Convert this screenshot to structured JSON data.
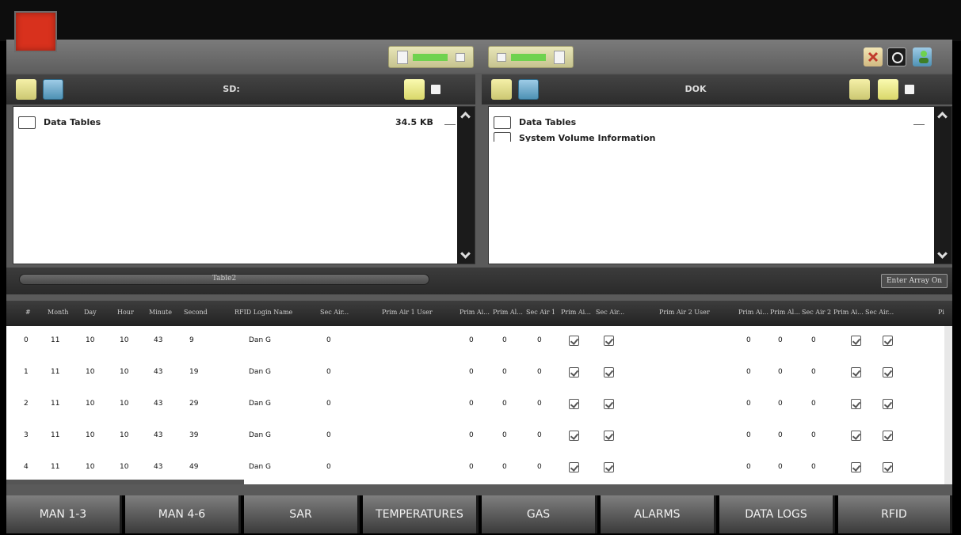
{
  "left_pane": {
    "title": "SD:",
    "files": [
      {
        "name": "Data Tables",
        "size": "34.5 KB"
      }
    ]
  },
  "right_pane": {
    "title": "DOK",
    "files": [
      {
        "name": "Data Tables"
      },
      {
        "name": "System Volume Information"
      }
    ]
  },
  "table_select": {
    "value": "Table2"
  },
  "enter_array_label": "Enter Array On",
  "grid": {
    "columns": [
      "#",
      "Month",
      "Day",
      "Hour",
      "Minute",
      "Second",
      "RFID Login Name",
      "Sec Air...",
      "Prim Air 1 User",
      "Prim Ai...",
      "Prim Al...",
      "Sec Air 1",
      "Prim Ai...",
      "Sec Air...",
      "Prim Air 2 User",
      "Prim Ai...",
      "Prim Al...",
      "Sec Air 2",
      "Prim Ai...",
      "Sec Air...",
      "Pi"
    ],
    "rows": [
      {
        "index": "0",
        "month": "11",
        "day": "10",
        "hour": "10",
        "minute": "43",
        "second": "9",
        "name": "Dan G",
        "sec_air": "0",
        "a": "0",
        "b": "0",
        "c": "0",
        "d": "0",
        "e": "0",
        "f": "0"
      },
      {
        "index": "1",
        "month": "11",
        "day": "10",
        "hour": "10",
        "minute": "43",
        "second": "19",
        "name": "Dan G",
        "sec_air": "0",
        "a": "0",
        "b": "0",
        "c": "0",
        "d": "0",
        "e": "0",
        "f": "0"
      },
      {
        "index": "2",
        "month": "11",
        "day": "10",
        "hour": "10",
        "minute": "43",
        "second": "29",
        "name": "Dan G",
        "sec_air": "0",
        "a": "0",
        "b": "0",
        "c": "0",
        "d": "0",
        "e": "0",
        "f": "0"
      },
      {
        "index": "3",
        "month": "11",
        "day": "10",
        "hour": "10",
        "minute": "43",
        "second": "39",
        "name": "Dan G",
        "sec_air": "0",
        "a": "0",
        "b": "0",
        "c": "0",
        "d": "0",
        "e": "0",
        "f": "0"
      },
      {
        "index": "4",
        "month": "11",
        "day": "10",
        "hour": "10",
        "minute": "43",
        "second": "49",
        "name": "Dan G",
        "sec_air": "0",
        "a": "0",
        "b": "0",
        "c": "0",
        "d": "0",
        "e": "0",
        "f": "0"
      }
    ]
  },
  "tabs": [
    "MAN 1-3",
    "MAN 4-6",
    "SAR",
    "TEMPERATURES",
    "GAS",
    "ALARMS",
    "DATA LOGS",
    "RFID"
  ],
  "icons": {
    "close": "close-icon",
    "refresh": "refresh-icon",
    "user": "user-icon",
    "folder": "folder-icon"
  },
  "colors": {
    "accent_red": "#d8311d",
    "arrow_green": "#6fd24f"
  }
}
